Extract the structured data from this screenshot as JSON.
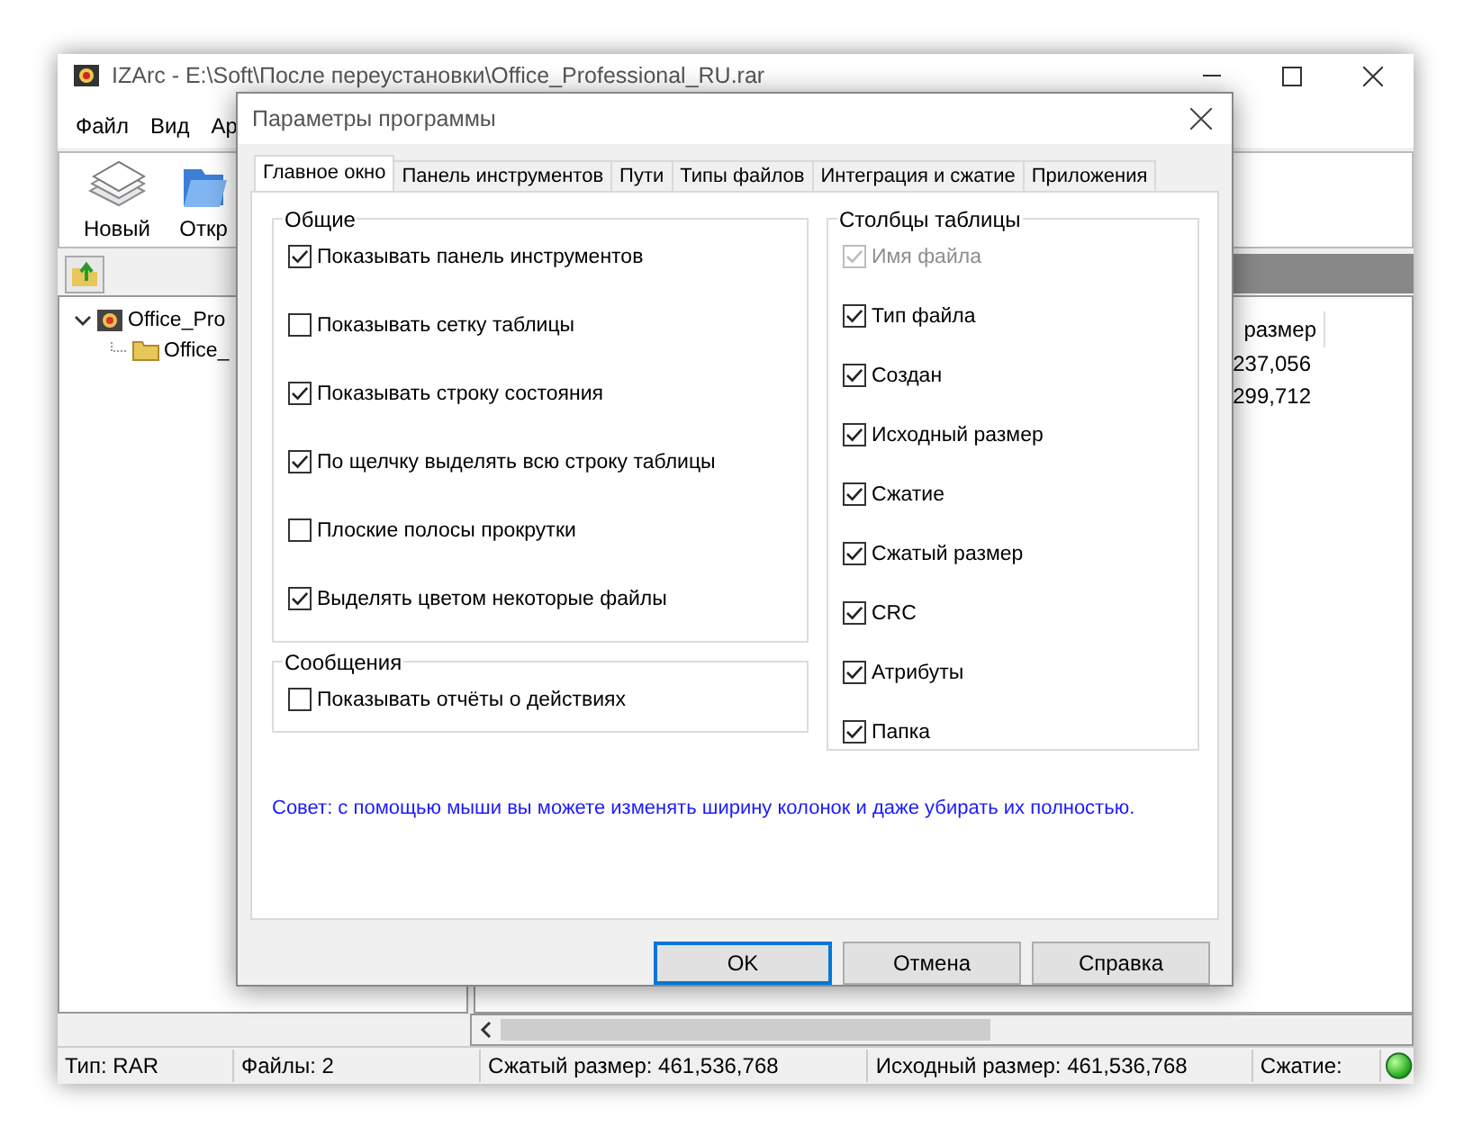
{
  "main_window": {
    "title": "IZArc - E:\\Soft\\После переустановки\\Office_Professional_RU.rar",
    "menu": [
      "Файл",
      "Вид",
      "Ар"
    ],
    "toolbar": [
      {
        "kind": "new",
        "label": "Новый"
      },
      {
        "kind": "open",
        "label": "Откр"
      }
    ],
    "tree": [
      {
        "label": "Office_Pro",
        "expanded": true,
        "children": [
          {
            "label": "Office_"
          }
        ]
      }
    ],
    "table": {
      "columns": [
        "размер"
      ],
      "rows": [
        [
          "237,056"
        ],
        [
          "299,712"
        ]
      ]
    },
    "status_bar": [
      "Тип: RAR",
      "Файлы: 2",
      "Сжатый размер: 461,536,768",
      "Исходный размер: 461,536,768",
      "Сжатие:"
    ]
  },
  "dialog": {
    "title": "Параметры программы",
    "tabs": [
      {
        "label": "Главное окно",
        "selected": true
      },
      {
        "label": "Панель инструментов",
        "selected": false
      },
      {
        "label": "Пути",
        "selected": false
      },
      {
        "label": "Типы файлов",
        "selected": false
      },
      {
        "label": "Интеграция и сжатие",
        "selected": false
      },
      {
        "label": "Приложения",
        "selected": false
      }
    ],
    "general": {
      "title": "Общие",
      "options": [
        {
          "label": "Показывать панель инструментов",
          "checked": true,
          "disabled": false
        },
        {
          "label": "Показывать сетку таблицы",
          "checked": false,
          "disabled": false
        },
        {
          "label": "Показывать строку состояния",
          "checked": true,
          "disabled": false
        },
        {
          "label": "По щелчку выделять всю строку таблицы",
          "checked": true,
          "disabled": false
        },
        {
          "label": "Плоские полосы прокрутки",
          "checked": false,
          "disabled": false
        },
        {
          "label": "Выделять цветом некоторые файлы",
          "checked": true,
          "disabled": false
        }
      ]
    },
    "messages": {
      "title": "Сообщения",
      "options": [
        {
          "label": "Показывать отчёты о действиях",
          "checked": false,
          "disabled": false
        }
      ]
    },
    "columns": {
      "title": "Столбцы таблицы",
      "options": [
        {
          "label": "Имя файла",
          "checked": true,
          "disabled": true
        },
        {
          "label": "Тип файла",
          "checked": true,
          "disabled": false
        },
        {
          "label": "Создан",
          "checked": true,
          "disabled": false
        },
        {
          "label": "Исходный размер",
          "checked": true,
          "disabled": false
        },
        {
          "label": "Сжатие",
          "checked": true,
          "disabled": false
        },
        {
          "label": "Сжатый размер",
          "checked": true,
          "disabled": false
        },
        {
          "label": "CRC",
          "checked": true,
          "disabled": false
        },
        {
          "label": "Атрибуты",
          "checked": true,
          "disabled": false
        },
        {
          "label": "Папка",
          "checked": true,
          "disabled": false
        }
      ]
    },
    "tip": "Совет: с помощью мыши вы можете изменять ширину колонок и даже убирать их полностью.",
    "buttons": [
      {
        "label": "OK",
        "default": true
      },
      {
        "label": "Отмена",
        "default": false
      },
      {
        "label": "Справка",
        "default": false
      }
    ]
  }
}
